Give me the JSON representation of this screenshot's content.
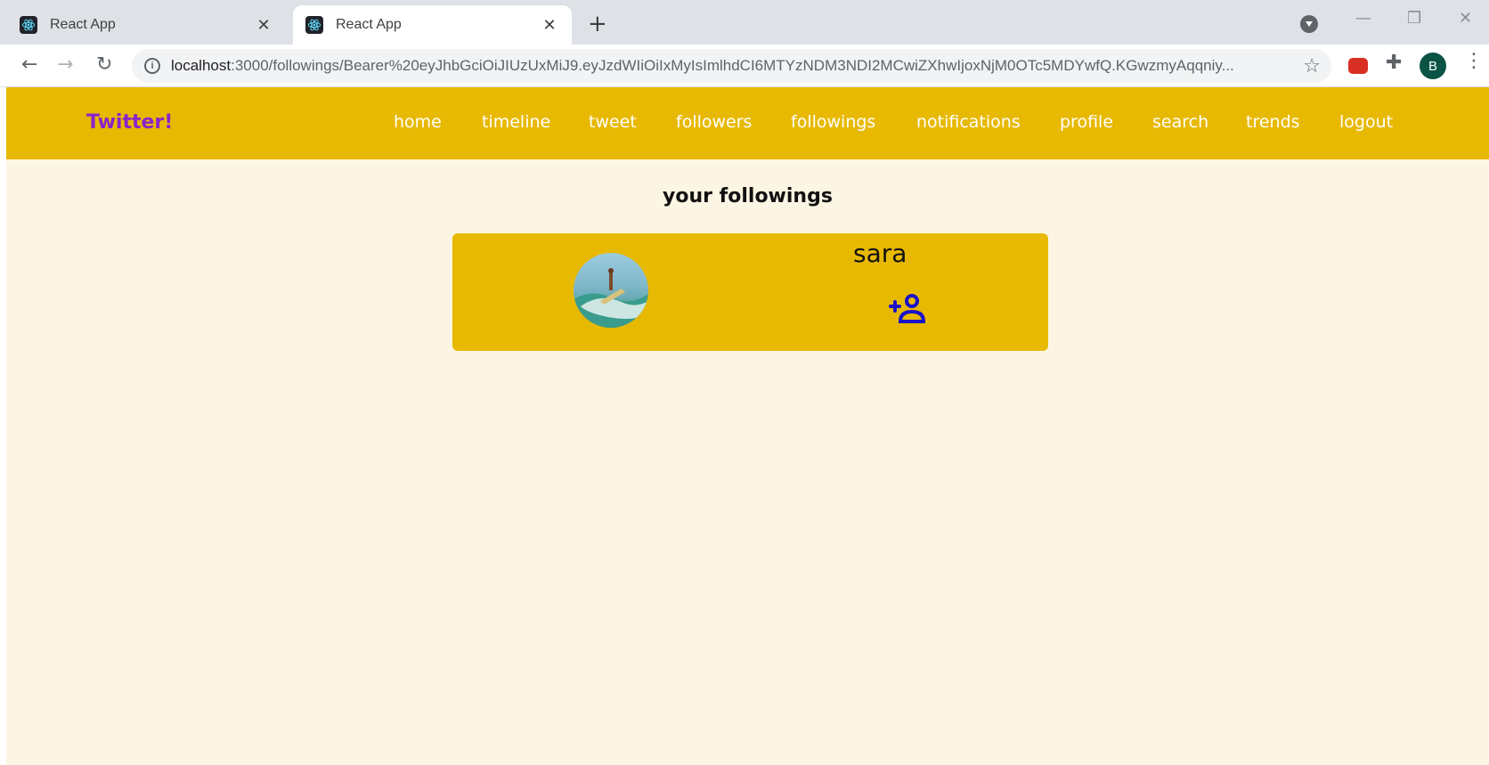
{
  "browser": {
    "tabs": [
      {
        "title": "React App",
        "active": false
      },
      {
        "title": "React App",
        "active": true
      }
    ],
    "address": {
      "host": "localhost",
      "path": ":3000/followings/Bearer%20eyJhbGciOiJIUzUxMiJ9.eyJzdWIiOiIxMyIsImlhdCI6MTYzNDM3NDI2MCwiZXhwIjoxNjM0OTc5MDYwfQ.KGwzmyAqqniy..."
    },
    "profile_initial": "B"
  },
  "app": {
    "brand": "Twitter!",
    "nav": [
      "home",
      "timeline",
      "tweet",
      "followers",
      "followings",
      "notifications",
      "profile",
      "search",
      "trends",
      "logout"
    ],
    "page_title": "your followings",
    "followings": [
      {
        "username": "sara"
      }
    ]
  },
  "colors": {
    "nav_bg": "#e8b903",
    "page_bg": "#fdf5e3",
    "brand": "#8a24c9",
    "follow_icon": "#1a12c9"
  }
}
